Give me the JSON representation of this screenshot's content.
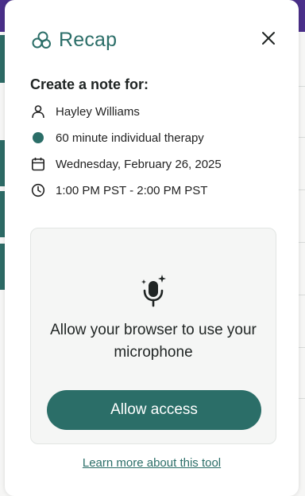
{
  "app": {
    "name": "Recap"
  },
  "header": {
    "close_label": "Close"
  },
  "note": {
    "title": "Create a note for:",
    "client_name": "Hayley Williams",
    "session_type": "60 minute individual therapy",
    "date": "Wednesday, February 26, 2025",
    "time": "1:00 PM PST - 2:00 PM PST"
  },
  "microphone_card": {
    "message": "Allow your browser to use your microphone",
    "allow_button": "Allow access"
  },
  "footer": {
    "learn_more": "Learn more about this tool"
  },
  "colors": {
    "accent": "#2b6e68",
    "card_bg": "#f5f6f5",
    "background_topbar": "#4a2f8a"
  },
  "icons": [
    "recap-logo-icon",
    "close-icon",
    "person-icon",
    "status-dot-icon",
    "calendar-icon",
    "clock-icon",
    "microphone-sparkle-icon"
  ]
}
